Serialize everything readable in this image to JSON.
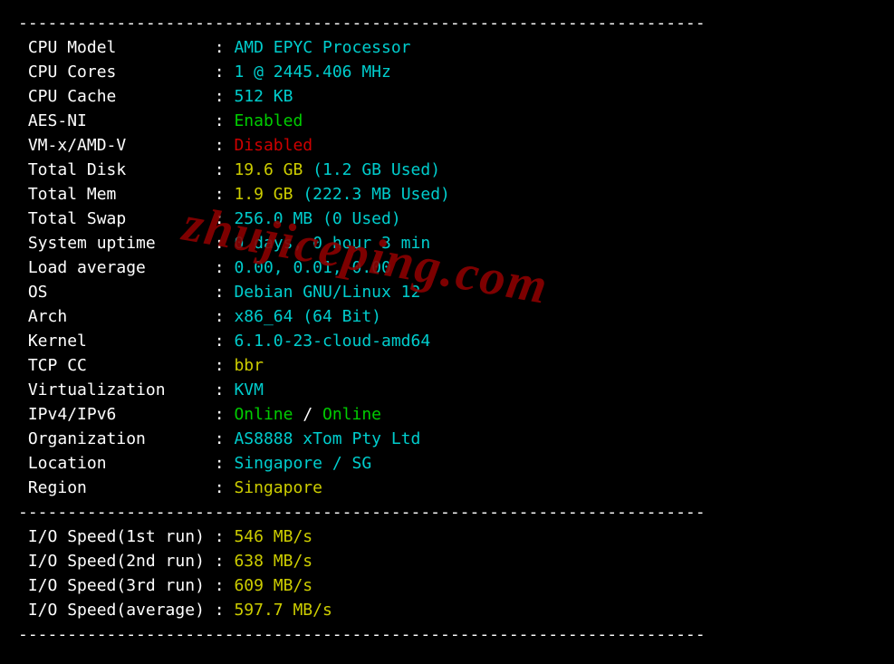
{
  "dash1": "----------------------------------------------------------------------",
  "dash2": "----------------------------------------------------------------------",
  "dash3": "----------------------------------------------------------------------",
  "watermark": "zhujiceping.com",
  "labels": {
    "cpu_model": "CPU Model",
    "cpu_cores": "CPU Cores",
    "cpu_cache": "CPU Cache",
    "aes_ni": "AES-NI",
    "vmx": "VM-x/AMD-V",
    "total_disk": "Total Disk",
    "total_mem": "Total Mem",
    "total_swap": "Total Swap",
    "uptime": "System uptime",
    "loadavg": "Load average",
    "os": "OS",
    "arch": "Arch",
    "kernel": "Kernel",
    "tcp_cc": "TCP CC",
    "virtualization": "Virtualization",
    "ipv46": "IPv4/IPv6",
    "organization": "Organization",
    "location": "Location",
    "region": "Region",
    "io1": "I/O Speed(1st run)",
    "io2": "I/O Speed(2nd run)",
    "io3": "I/O Speed(3rd run)",
    "ioavg": "I/O Speed(average)"
  },
  "sep": ":",
  "values": {
    "cpu_model": "AMD EPYC Processor",
    "cpu_cores": "1 @ 2445.406 MHz",
    "cpu_cache": "512 KB",
    "aes_ni": "Enabled",
    "vmx": "Disabled",
    "total_disk_size": "19.6 GB",
    "total_disk_used": "(1.2 GB Used)",
    "total_mem_size": "1.9 GB",
    "total_mem_used": "(222.3 MB Used)",
    "total_swap_size": "256.0 MB",
    "total_swap_used": "(0 Used)",
    "uptime": "0 days, 0 hour 3 min",
    "loadavg": "0.00, 0.01, 0.00",
    "os": "Debian GNU/Linux 12",
    "arch": "x86_64 (64 Bit)",
    "kernel": "6.1.0-23-cloud-amd64",
    "tcp_cc": "bbr",
    "virtualization": "KVM",
    "ipv4_status": "Online",
    "ip_sep": " / ",
    "ipv6_status": "Online",
    "organization": "AS8888 xTom Pty Ltd",
    "location": "Singapore / SG",
    "region": "Singapore",
    "io1": "546 MB/s",
    "io2": "638 MB/s",
    "io3": "609 MB/s",
    "ioavg": "597.7 MB/s"
  }
}
